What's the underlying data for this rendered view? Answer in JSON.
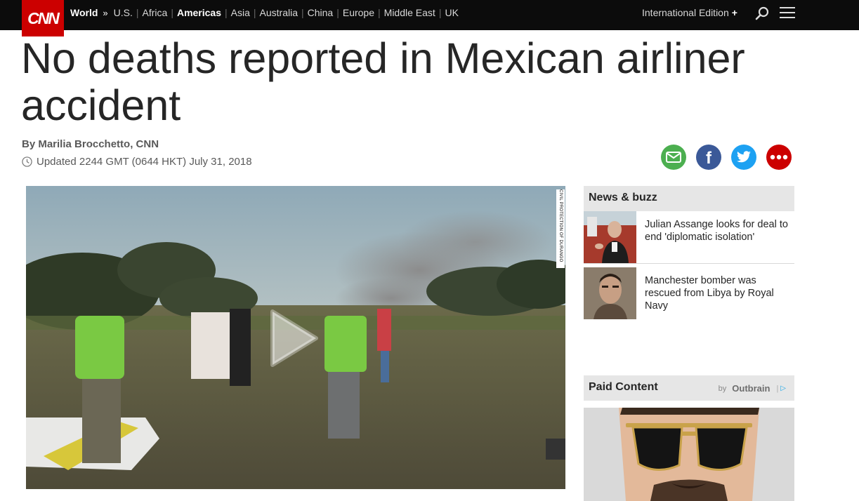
{
  "nav": {
    "logo": "CNN",
    "section": "World",
    "chevron": "»",
    "regions": [
      {
        "label": "U.S.",
        "active": false
      },
      {
        "label": "Africa",
        "active": false
      },
      {
        "label": "Americas",
        "active": true
      },
      {
        "label": "Asia",
        "active": false
      },
      {
        "label": "Australia",
        "active": false
      },
      {
        "label": "China",
        "active": false
      },
      {
        "label": "Europe",
        "active": false
      },
      {
        "label": "Middle East",
        "active": false
      },
      {
        "label": "UK",
        "active": false
      }
    ],
    "edition": "International Edition",
    "edition_plus": "+",
    "icons": [
      "search-icon",
      "hamburger-menu-icon"
    ]
  },
  "article": {
    "headline": "No deaths reported in Mexican airliner accident",
    "byline": "By Marilia Brocchetto, CNN",
    "updated": "Updated 2244 GMT (0644 HKT) July 31, 2018"
  },
  "share": {
    "icons": [
      "email-share-icon",
      "facebook-share-icon",
      "twitter-share-icon",
      "more-share-icon"
    ],
    "facebook_glyph": "f"
  },
  "video": {
    "photo_credit": "CIVIL PROTECTION OF DURANGO",
    "icons": [
      "play-icon"
    ]
  },
  "sidebar": {
    "news_title": "News & buzz",
    "stories": [
      {
        "title": "Julian Assange looks for deal to end 'diplomatic isolation'"
      },
      {
        "title": "Manchester bomber was rescued from Libya by Royal Navy"
      }
    ],
    "paid_title": "Paid Content",
    "outbrain_by": "by",
    "outbrain_brand": "Outbrain",
    "outbrain_bar": "|",
    "adchoice": "▷"
  },
  "colors": {
    "brand_red": "#cc0000",
    "nav_bg": "#0c0c0c",
    "email_green": "#4caf50",
    "facebook_blue": "#3b5998",
    "twitter_blue": "#1da1f2"
  }
}
